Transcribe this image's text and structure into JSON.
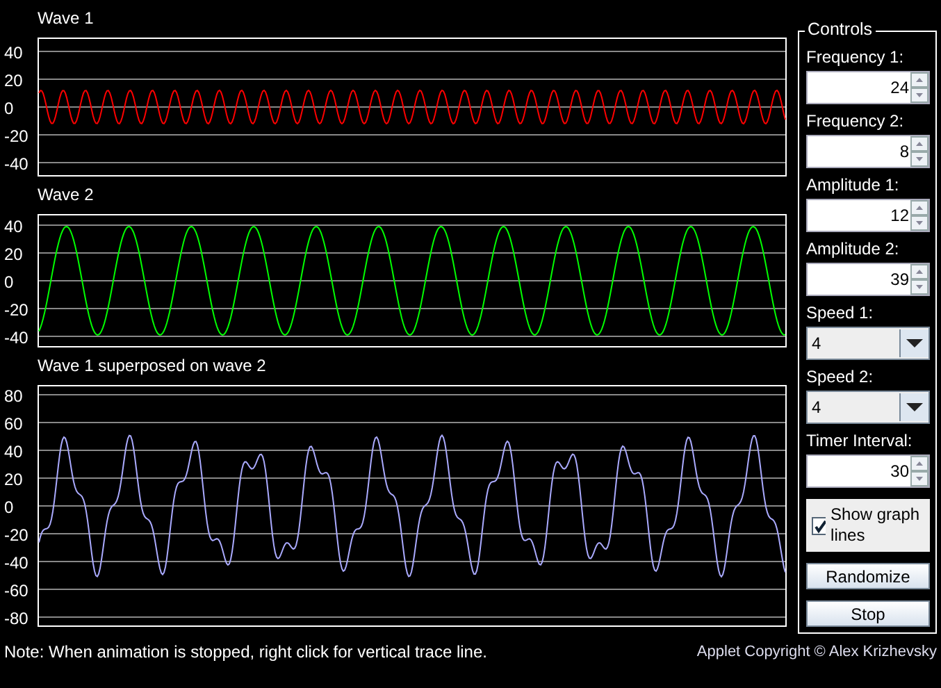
{
  "graphs": [
    {
      "kind": "wave1",
      "title": "Wave 1",
      "color": "#ff0000",
      "yticks": [
        "40",
        "20",
        "0",
        "-20",
        "-40"
      ]
    },
    {
      "kind": "wave2",
      "title": "Wave 2",
      "color": "#00ff00",
      "yticks": [
        "40",
        "20",
        "0",
        "-20",
        "-40"
      ]
    },
    {
      "kind": "sum",
      "title": "Wave 1 superposed on wave 2",
      "color": "#aaaaff",
      "yticks": [
        "80",
        "60",
        "40",
        "20",
        "0",
        "-20",
        "-40",
        "-60",
        "-80"
      ]
    }
  ],
  "controls": {
    "title": "Controls",
    "fields": [
      {
        "kind": "spinner",
        "label": "Frequency 1:",
        "value": "24"
      },
      {
        "kind": "spinner",
        "label": "Frequency 2:",
        "value": "8"
      },
      {
        "kind": "spinner",
        "label": "Amplitude 1:",
        "value": "12"
      },
      {
        "kind": "spinner",
        "label": "Amplitude 2:",
        "value": "39"
      },
      {
        "kind": "dropdown",
        "label": "Speed 1:",
        "value": "4"
      },
      {
        "kind": "dropdown",
        "label": "Speed 2:",
        "value": "4"
      },
      {
        "kind": "spinner",
        "label": "Timer Interval:",
        "value": "30"
      }
    ],
    "show_graph_lines": {
      "label": "Show graph lines",
      "checked": true
    },
    "buttons": [
      "Randomize",
      "Stop"
    ]
  },
  "note": "Note: When animation is stopped, right click for vertical trace line.",
  "copyright": "Applet Copyright © Alex Krizhevsky"
}
